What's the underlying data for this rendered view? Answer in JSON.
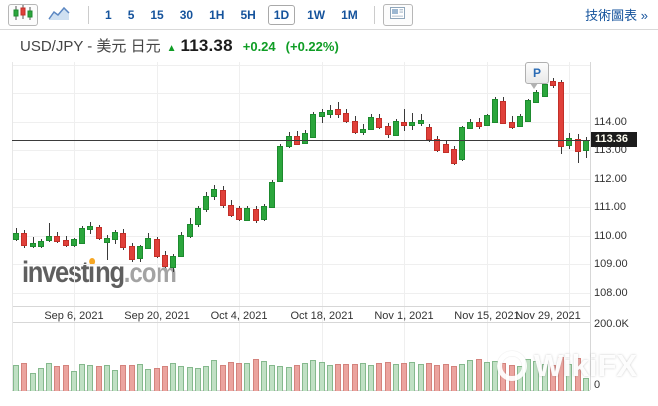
{
  "toolbar": {
    "intervals": [
      "1",
      "5",
      "15",
      "30",
      "1H",
      "5H",
      "1D",
      "1W",
      "1M"
    ],
    "selected_interval": "1D",
    "technical_link": "技術圖表 »"
  },
  "header": {
    "pair_label": "USD/JPY - 美元 日元",
    "arrow": "▲",
    "price": "113.38",
    "change": "+0.24",
    "change_pct": "(+0.22%)"
  },
  "watermarks": {
    "investing_part1": "invest",
    "investing_part2": "i",
    "investing_part3": "ng",
    "investing_suffix": ".com",
    "wikifx_text": "WikiFX"
  },
  "colors": {
    "up_fill": "#2ba63c",
    "up_border": "#1d8a2e",
    "down_fill": "#e0403a",
    "down_border": "#c22f28",
    "vol_up_fill": "#c0e0c4",
    "vol_up_border": "#85b98d",
    "vol_down_fill": "#eba49f",
    "vol_down_border": "#d4837d",
    "accent_blue": "#15539c",
    "change_green": "#0f9d25",
    "badge_bg": "#1c1c1c"
  },
  "chart_data": {
    "type": "candlestick",
    "title": "USD/JPY daily candlestick with volume",
    "last_price": 113.36,
    "last_price_label": "113.36",
    "y_axis": {
      "gridline_prices": [
        116,
        115,
        114,
        113,
        112,
        111,
        110,
        109,
        108
      ],
      "labels": [
        {
          "text": "114.00",
          "price": 114
        },
        {
          "text": "113.00",
          "price": 113
        },
        {
          "text": "112.00",
          "price": 112
        },
        {
          "text": "111.00",
          "price": 111
        },
        {
          "text": "110.00",
          "price": 110
        },
        {
          "text": "109.00",
          "price": 109
        },
        {
          "text": "108.00",
          "price": 108
        }
      ]
    },
    "x_ticks": [
      {
        "label": "Sep 6, 2021",
        "i": 7
      },
      {
        "label": "Sep 20, 2021",
        "i": 17
      },
      {
        "label": "Oct 4, 2021",
        "i": 27
      },
      {
        "label": "Oct 18, 2021",
        "i": 37
      },
      {
        "label": "Nov 1, 2021",
        "i": 47
      },
      {
        "label": "Nov 15, 2021",
        "i": 57
      },
      {
        "label": "Nov 29, 2021",
        "i": 67
      }
    ],
    "volume_axis": {
      "max_k": 200,
      "top_label": "200.0K",
      "bottom_label": "0"
    },
    "marker": {
      "label": "P",
      "candle_index": 63
    },
    "candles": [
      [
        "Aug 26",
        109.92,
        110.28,
        109.82,
        110.1,
        74
      ],
      [
        "Aug 27",
        110.08,
        110.2,
        109.58,
        109.68,
        79
      ],
      [
        "Aug 30",
        109.72,
        109.95,
        109.58,
        109.75,
        50
      ],
      [
        "Aug 31",
        109.68,
        109.88,
        109.55,
        109.82,
        65
      ],
      [
        "Sep 1",
        109.88,
        110.45,
        109.78,
        109.98,
        79
      ],
      [
        "Sep 2",
        109.98,
        110.12,
        109.75,
        109.85,
        71
      ],
      [
        "Sep 3",
        109.85,
        109.98,
        109.58,
        109.7,
        74
      ],
      [
        "Sep 6",
        109.7,
        109.92,
        109.6,
        109.86,
        56
      ],
      [
        "Sep 7",
        109.78,
        110.32,
        109.7,
        110.26,
        76
      ],
      [
        "Sep 8",
        110.26,
        110.48,
        110.05,
        110.32,
        74
      ],
      [
        "Sep 9",
        110.3,
        110.38,
        109.85,
        109.95,
        71
      ],
      [
        "Sep 10",
        109.8,
        110.02,
        109.15,
        109.92,
        74
      ],
      [
        "Sep 13",
        109.92,
        110.18,
        109.7,
        110.12,
        59
      ],
      [
        "Sep 14",
        110.1,
        110.22,
        109.48,
        109.65,
        74
      ],
      [
        "Sep 15",
        109.62,
        109.75,
        109.08,
        109.2,
        74
      ],
      [
        "Sep 16",
        109.22,
        109.68,
        109.08,
        109.62,
        76
      ],
      [
        "Sep 17",
        109.62,
        110.08,
        109.52,
        109.92,
        62
      ],
      [
        "Sep 20",
        109.88,
        109.95,
        109.22,
        109.32,
        65
      ],
      [
        "Sep 21",
        109.3,
        109.45,
        108.85,
        108.94,
        71
      ],
      [
        "Sep 22",
        108.92,
        109.35,
        108.72,
        109.28,
        79
      ],
      [
        "Sep 23",
        109.32,
        110.12,
        109.28,
        110.02,
        71
      ],
      [
        "Sep 24",
        110.02,
        110.62,
        109.92,
        110.42,
        68
      ],
      [
        "Sep 27",
        110.42,
        111.05,
        110.32,
        110.95,
        65
      ],
      [
        "Sep 28",
        110.95,
        111.52,
        110.82,
        111.38,
        71
      ],
      [
        "Sep 29",
        111.4,
        111.78,
        111.25,
        111.62,
        88
      ],
      [
        "Sep 30",
        111.6,
        111.72,
        110.95,
        111.1,
        74
      ],
      [
        "Oct 1",
        111.08,
        111.25,
        110.65,
        110.78,
        82
      ],
      [
        "Oct 4",
        110.95,
        111.02,
        110.5,
        110.6,
        79
      ],
      [
        "Oct 5",
        110.58,
        111.02,
        110.48,
        110.95,
        79
      ],
      [
        "Oct 6",
        110.92,
        111.05,
        110.45,
        110.58,
        91
      ],
      [
        "Oct 7",
        110.6,
        111.12,
        110.52,
        111.02,
        85
      ],
      [
        "Oct 8",
        111.05,
        111.95,
        111.0,
        111.88,
        74
      ],
      [
        "Oct 11",
        111.95,
        113.2,
        111.9,
        113.15,
        71
      ],
      [
        "Oct 12",
        113.18,
        113.62,
        113.05,
        113.48,
        68
      ],
      [
        "Oct 13",
        113.5,
        113.65,
        113.15,
        113.25,
        74
      ],
      [
        "Oct 14",
        113.28,
        113.7,
        113.2,
        113.58,
        79
      ],
      [
        "Oct 15",
        113.48,
        114.32,
        113.42,
        114.25,
        88
      ],
      [
        "Oct 18",
        114.22,
        114.45,
        113.95,
        114.32,
        82
      ],
      [
        "Oct 19",
        114.32,
        114.58,
        114.12,
        114.42,
        74
      ],
      [
        "Oct 20",
        114.45,
        114.7,
        114.15,
        114.3,
        76
      ],
      [
        "Oct 21",
        114.3,
        114.45,
        113.95,
        114.05,
        76
      ],
      [
        "Oct 22",
        114.02,
        114.18,
        113.55,
        113.68,
        76
      ],
      [
        "Oct 25",
        113.68,
        113.92,
        113.52,
        113.75,
        79
      ],
      [
        "Oct 26",
        113.75,
        114.25,
        113.7,
        114.15,
        74
      ],
      [
        "Oct 27",
        114.12,
        114.28,
        113.75,
        113.85,
        79
      ],
      [
        "Oct 28",
        113.84,
        113.95,
        113.42,
        113.58,
        82
      ],
      [
        "Oct 29",
        113.58,
        114.1,
        113.52,
        114.02,
        76
      ],
      [
        "Nov 1",
        114.0,
        114.45,
        113.68,
        113.95,
        79
      ],
      [
        "Nov 2",
        113.95,
        114.3,
        113.7,
        113.98,
        82
      ],
      [
        "Nov 3",
        113.98,
        114.25,
        113.82,
        114.06,
        76
      ],
      [
        "Nov 4",
        113.8,
        113.92,
        113.3,
        113.4,
        79
      ],
      [
        "Nov 5",
        113.38,
        113.5,
        112.95,
        113.02,
        74
      ],
      [
        "Nov 8",
        113.2,
        113.32,
        112.9,
        112.96,
        76
      ],
      [
        "Nov 9",
        113.05,
        113.15,
        112.5,
        112.6,
        71
      ],
      [
        "Nov 10",
        112.7,
        113.85,
        112.62,
        113.8,
        76
      ],
      [
        "Nov 11",
        113.82,
        114.08,
        113.72,
        114.0,
        88
      ],
      [
        "Nov 12",
        114.0,
        114.12,
        113.75,
        113.88,
        91
      ],
      [
        "Nov 15",
        113.92,
        114.28,
        113.85,
        114.22,
        82
      ],
      [
        "Nov 16",
        114.0,
        114.85,
        113.95,
        114.78,
        85
      ],
      [
        "Nov 17",
        114.72,
        114.85,
        113.92,
        113.98,
        79
      ],
      [
        "Nov 18",
        113.98,
        114.2,
        113.75,
        113.85,
        74
      ],
      [
        "Nov 19",
        113.88,
        114.25,
        113.82,
        114.18,
        71
      ],
      [
        "Nov 22",
        114.05,
        114.8,
        113.98,
        114.76,
        91
      ],
      [
        "Nov 23",
        114.72,
        115.1,
        114.65,
        115.05,
        85
      ],
      [
        "Nov 24",
        114.92,
        115.52,
        114.85,
        115.32,
        76
      ],
      [
        "Nov 25",
        115.42,
        115.52,
        115.18,
        115.3,
        74
      ],
      [
        "Nov 26",
        115.37,
        115.45,
        112.85,
        113.15,
        97
      ],
      [
        "Nov 29",
        113.2,
        113.6,
        113.05,
        113.42,
        76
      ],
      [
        "Nov 30",
        113.4,
        113.55,
        112.55,
        113.0,
        94
      ],
      [
        "Dec 1",
        113.05,
        113.45,
        112.7,
        113.36,
        35
      ]
    ]
  }
}
